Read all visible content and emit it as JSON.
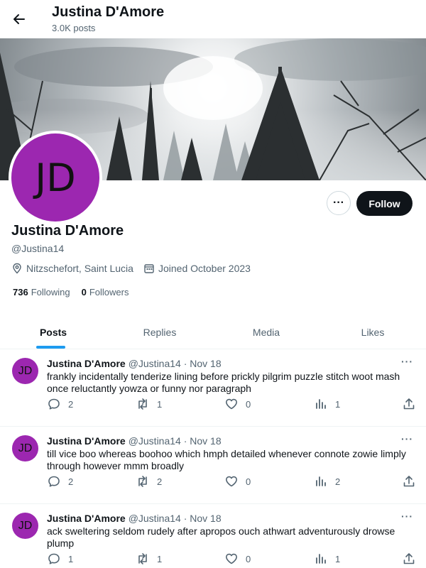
{
  "header": {
    "title": "Justina D'Amore",
    "subtitle": "3.0K posts"
  },
  "profile": {
    "initials": "JD",
    "name": "Justina D'Amore",
    "handle": "@Justina14",
    "location": "Nitzschefort, Saint Lucia",
    "joined": "Joined October 2023",
    "following_count": "736",
    "following_label": "Following",
    "followers_count": "0",
    "followers_label": "Followers",
    "more_label": "···",
    "follow_label": "Follow"
  },
  "tabs": [
    {
      "label": "Posts"
    },
    {
      "label": "Replies"
    },
    {
      "label": "Media"
    },
    {
      "label": "Likes"
    }
  ],
  "posts": [
    {
      "initials": "JD",
      "name": "Justina D'Amore",
      "meta": "@Justina14 · Nov 18",
      "text": "frankly incidentally tenderize lining before prickly pilgrim puzzle stitch woot mash once reluctantly yowza or funny nor paragraph",
      "replies": "2",
      "reposts": "1",
      "likes": "0",
      "views": "1"
    },
    {
      "initials": "JD",
      "name": "Justina D'Amore",
      "meta": "@Justina14 · Nov 18",
      "text": "till vice boo whereas boohoo which hmph detailed whenever connote zowie limply through however mmm broadly",
      "replies": "2",
      "reposts": "2",
      "likes": "0",
      "views": "2"
    },
    {
      "initials": "JD",
      "name": "Justina D'Amore",
      "meta": "@Justina14 · Nov 18",
      "text": "ack sweltering seldom rudely after apropos ouch athwart adventurously drowse plump",
      "replies": "1",
      "reposts": "1",
      "likes": "0",
      "views": "1"
    }
  ],
  "colors": {
    "accent": "#1d9bf0",
    "avatar": "#9c27b0",
    "text": "#0f1419",
    "muted": "#536471"
  },
  "icons": [
    "back-arrow-icon",
    "location-icon",
    "calendar-icon",
    "reply-icon",
    "repost-icon",
    "like-icon",
    "views-icon",
    "share-icon",
    "more-icon"
  ]
}
